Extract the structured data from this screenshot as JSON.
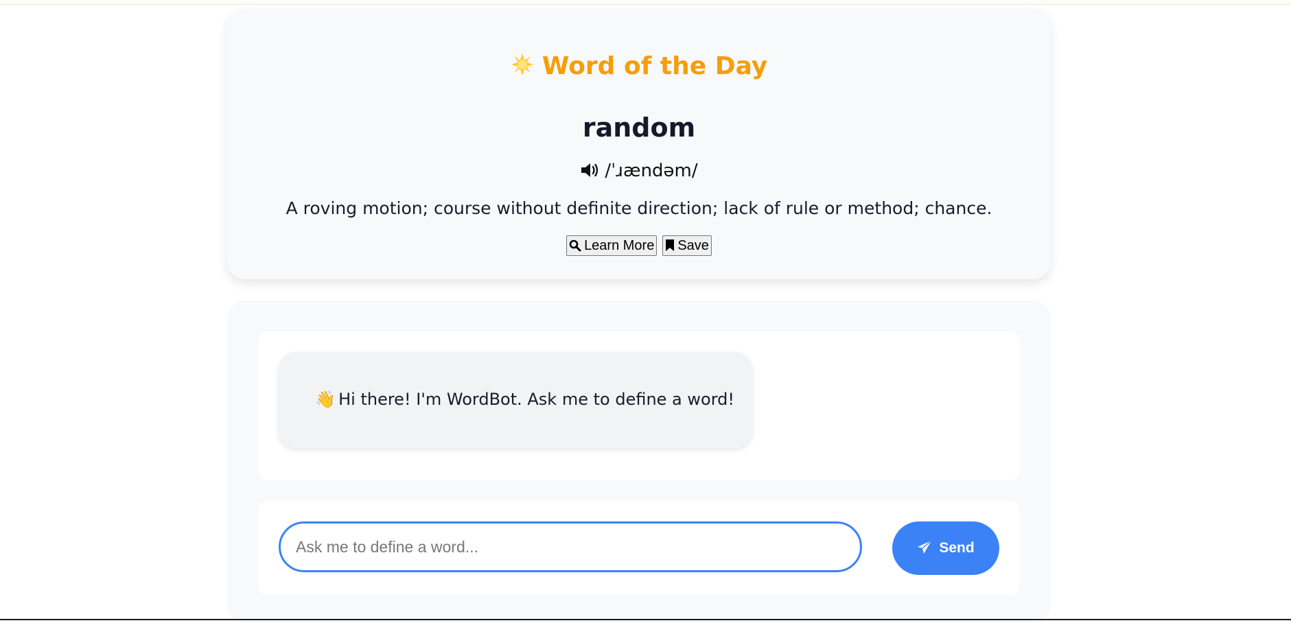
{
  "word_of_the_day": {
    "heading": "Word of the Day",
    "heading_icon": "sun-icon",
    "word": "random",
    "pronunciation": "/ˈɹændəm/",
    "pronunciation_icon": "speaker-icon",
    "definition": "A roving motion; course without definite direction; lack of rule or method; chance.",
    "learn_more_label": "Learn More",
    "learn_more_icon": "search-icon",
    "save_label": "Save",
    "save_icon": "bookmark-icon"
  },
  "chat": {
    "messages": [
      {
        "sender": "bot",
        "emoji": "👋",
        "text": "Hi there! I'm WordBot. Ask me to define a word!"
      }
    ],
    "input_placeholder": "Ask me to define a word...",
    "input_value": "",
    "send_label": "Send",
    "send_icon": "paper-plane-icon"
  },
  "colors": {
    "heading": "#f59e0b",
    "accent": "#3b82f6",
    "card_background": "#f8f9fa",
    "bubble_background": "#f2f3f5"
  }
}
